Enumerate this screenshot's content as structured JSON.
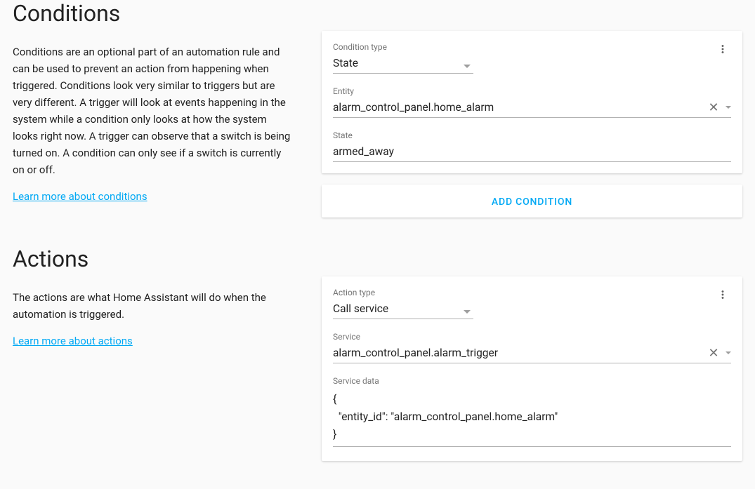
{
  "conditions": {
    "heading": "Conditions",
    "description": "Conditions are an optional part of an automation rule and can be used to prevent an action from happening when triggered. Conditions look very similar to triggers but are very different. A trigger will look at events happening in the system while a condition only looks at how the system looks right now. A trigger can observe that a switch is being turned on. A condition can only see if a switch is currently on or off.",
    "learn_link": "Learn more about conditions",
    "card": {
      "type_label": "Condition type",
      "type_value": "State",
      "entity_label": "Entity",
      "entity_value": "alarm_control_panel.home_alarm",
      "state_label": "State",
      "state_value": "armed_away"
    },
    "add_button": "Add Condition"
  },
  "actions": {
    "heading": "Actions",
    "description": "The actions are what Home Assistant will do when the automation is triggered.",
    "learn_link": "Learn more about actions",
    "card": {
      "type_label": "Action type",
      "type_value": "Call service",
      "service_label": "Service",
      "service_value": "alarm_control_panel.alarm_trigger",
      "service_data_label": "Service data",
      "service_data_value": "{\n  \"entity_id\": \"alarm_control_panel.home_alarm\"\n}"
    }
  },
  "colors": {
    "accent": "#03a9f4"
  }
}
